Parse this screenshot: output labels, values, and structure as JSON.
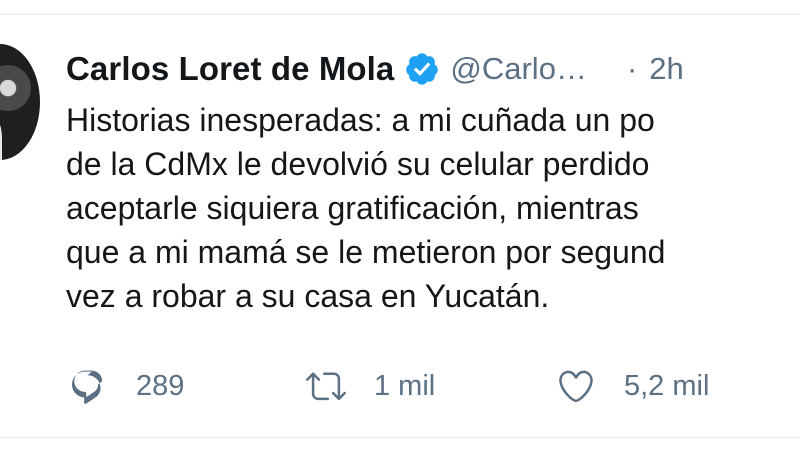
{
  "user": {
    "display_name": "Carlos Loret de Mola",
    "handle": "@Carlo…",
    "separator": "·",
    "timestamp": "2h"
  },
  "tweet": {
    "lines": [
      "Historias inesperadas: a mi cuñada un po",
      "de la CdMx le devolvió su celular perdido",
      "aceptarle siquiera gratificación, mientras",
      "que a mi mamá se le metieron por segund",
      "vez a robar a su casa en Yucatán."
    ]
  },
  "actions": {
    "reply_count": "289",
    "retweet_count": "1 mil",
    "like_count": "5,2 mil"
  },
  "colors": {
    "text": "#14171a",
    "secondary": "#5b7083",
    "verified": "#1da1f2",
    "divider": "#e6ecf0"
  },
  "icons": [
    "reply-icon",
    "retweet-icon",
    "like-icon",
    "verified-icon"
  ]
}
